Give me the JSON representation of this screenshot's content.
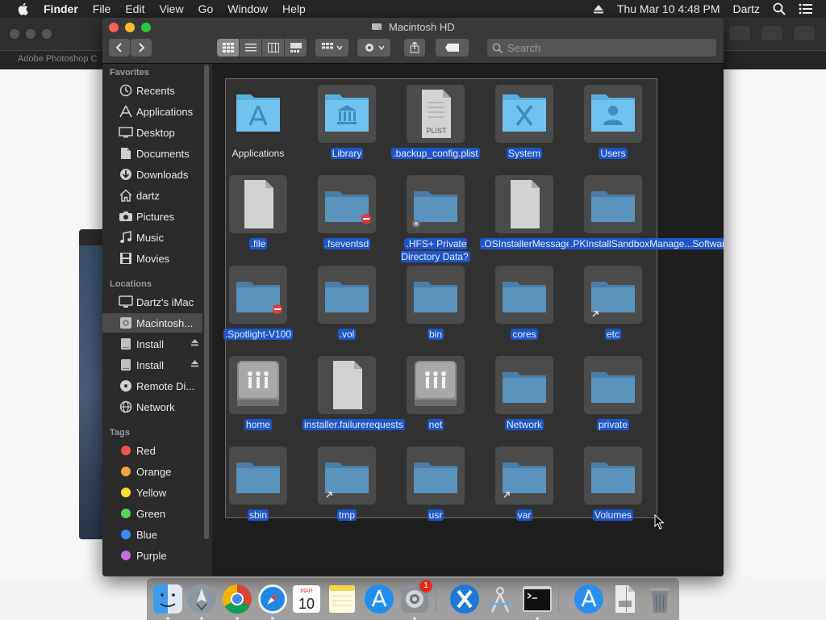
{
  "menubar": {
    "app": "Finder",
    "menus": [
      "File",
      "Edit",
      "View",
      "Go",
      "Window",
      "Help"
    ],
    "clock": "Thu Mar 10  4:48 PM",
    "user": "Dartz"
  },
  "background": {
    "tab_label": "Adobe Photoshop C"
  },
  "window": {
    "title": "Macintosh HD",
    "search_placeholder": "Search"
  },
  "sidebar": {
    "favorites_header": "Favorites",
    "favorites": [
      {
        "label": "Recents",
        "icon": "clock-icon"
      },
      {
        "label": "Applications",
        "icon": "applications-icon"
      },
      {
        "label": "Desktop",
        "icon": "desktop-icon"
      },
      {
        "label": "Documents",
        "icon": "document-icon"
      },
      {
        "label": "Downloads",
        "icon": "download-icon"
      },
      {
        "label": "dartz",
        "icon": "home-icon"
      },
      {
        "label": "Pictures",
        "icon": "camera-icon"
      },
      {
        "label": "Music",
        "icon": "music-note-icon"
      },
      {
        "label": "Movies",
        "icon": "film-icon"
      }
    ],
    "locations_header": "Locations",
    "locations": [
      {
        "label": "Dartz's iMac",
        "icon": "imac-icon"
      },
      {
        "label": "Macintosh...",
        "icon": "hard-disk-icon"
      },
      {
        "label": "Install",
        "icon": "drive-icon"
      },
      {
        "label": "Install",
        "icon": "drive-icon"
      },
      {
        "label": "Remote Di...",
        "icon": "disc-icon"
      },
      {
        "label": "Network",
        "icon": "globe-icon"
      }
    ],
    "tags_header": "Tags",
    "tags": [
      {
        "label": "Red",
        "color": "#f25353"
      },
      {
        "label": "Orange",
        "color": "#f5a23b"
      },
      {
        "label": "Yellow",
        "color": "#f6df33"
      },
      {
        "label": "Green",
        "color": "#4fd65a"
      },
      {
        "label": "Blue",
        "color": "#3a8cf2"
      },
      {
        "label": "Purple",
        "color": "#c66be0"
      }
    ]
  },
  "files": [
    {
      "name": "Applications",
      "kind": "folder-apps",
      "selected": false
    },
    {
      "name": "Library",
      "kind": "folder-library",
      "selected": true
    },
    {
      "name": ".backup_config.plist",
      "kind": "plist",
      "selected": true
    },
    {
      "name": "System",
      "kind": "folder-system",
      "selected": true
    },
    {
      "name": "Users",
      "kind": "folder-users",
      "selected": true
    },
    {
      "name": ".file",
      "kind": "doc",
      "selected": true
    },
    {
      "name": ".fseventsd",
      "kind": "folder-noentry",
      "selected": true
    },
    {
      "name": ".HFS+ Private Directory Data?",
      "kind": "folder-lock",
      "selected": true
    },
    {
      "name": ".OSInstallerMessages",
      "kind": "doc",
      "selected": true
    },
    {
      "name": ".PKInstallSandboxManage...Software",
      "kind": "folder",
      "selected": true
    },
    {
      "name": ".Spotlight-V100",
      "kind": "folder-noentry",
      "selected": true
    },
    {
      "name": ".vol",
      "kind": "folder",
      "selected": true
    },
    {
      "name": "bin",
      "kind": "folder",
      "selected": true
    },
    {
      "name": "cores",
      "kind": "folder",
      "selected": true
    },
    {
      "name": "etc",
      "kind": "folder-alias",
      "selected": true
    },
    {
      "name": "home",
      "kind": "network-drive",
      "selected": true
    },
    {
      "name": "installer.failurerequests",
      "kind": "doc",
      "selected": true
    },
    {
      "name": "net",
      "kind": "network-drive",
      "selected": true
    },
    {
      "name": "Network",
      "kind": "folder",
      "selected": true
    },
    {
      "name": "private",
      "kind": "folder",
      "selected": true
    },
    {
      "name": "sbin",
      "kind": "folder",
      "selected": true
    },
    {
      "name": "tmp",
      "kind": "folder-alias",
      "selected": true
    },
    {
      "name": "usr",
      "kind": "folder",
      "selected": true
    },
    {
      "name": "var",
      "kind": "folder-alias",
      "selected": true
    },
    {
      "name": "Volumes",
      "kind": "folder",
      "selected": true
    }
  ],
  "plist_label": "PLIST",
  "dock": {
    "badge_count": "1",
    "apps": [
      "finder-icon",
      "launchpad-icon",
      "chrome-icon",
      "safari-icon",
      "calendar-icon",
      "notes-icon",
      "app-store-icon",
      "system-preferences-icon",
      "xcode-icon",
      "instruments-icon",
      "terminal-icon",
      "installer-icon",
      "document-stack-icon",
      "trash-icon"
    ],
    "calendar_month": "MAR",
    "calendar_day": "10"
  }
}
